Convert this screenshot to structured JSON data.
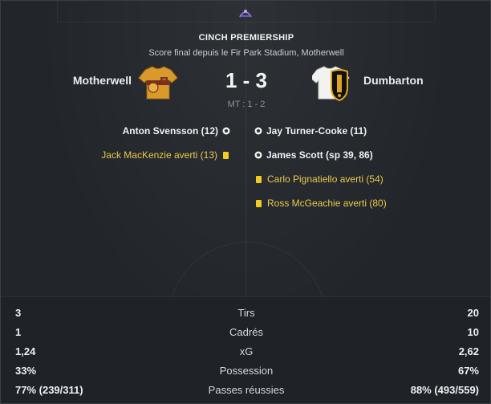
{
  "match": {
    "competition": "CINCH PREMIERSHIP",
    "venue": "Score final depuis le Fir Park Stadium, Motherwell",
    "home_team": "Motherwell",
    "away_team": "Dumbarton",
    "score": "1 - 3",
    "halftime": "MT : 1 - 2"
  },
  "colors": {
    "home_kit": "#d99a2b",
    "home_kit_dark": "#7a2f1d",
    "away_kit": "#f2f2f0",
    "away_badge": "#e0a520",
    "booking": "#e9c84a",
    "yellow_card": "#f2cd1f"
  },
  "events": {
    "home": [
      {
        "text": "Anton Svensson (12)",
        "type": "goal",
        "icon": "ball-icon"
      },
      {
        "text": "Jack MacKenzie averti (13)",
        "type": "booking",
        "icon": "yellow-card-icon"
      }
    ],
    "away": [
      {
        "text": "Jay Turner-Cooke (11)",
        "type": "goal",
        "icon": "ball-icon"
      },
      {
        "text": "James Scott (sp 39, 86)",
        "type": "goal",
        "icon": "ball-icon"
      },
      {
        "text": "Carlo Pignatiello averti (54)",
        "type": "booking",
        "icon": "yellow-card-icon"
      },
      {
        "text": "Ross McGeachie averti (80)",
        "type": "booking",
        "icon": "yellow-card-icon"
      }
    ]
  },
  "stats": [
    {
      "label": "Tirs",
      "home": "3",
      "away": "20"
    },
    {
      "label": "Cadrés",
      "home": "1",
      "away": "10"
    },
    {
      "label": "xG",
      "home": "1,24",
      "away": "2,62"
    },
    {
      "label": "Possession",
      "home": "33%",
      "away": "67%"
    },
    {
      "label": "Passes réussies",
      "home": "77% (239/311)",
      "away": "88% (493/559)"
    }
  ]
}
